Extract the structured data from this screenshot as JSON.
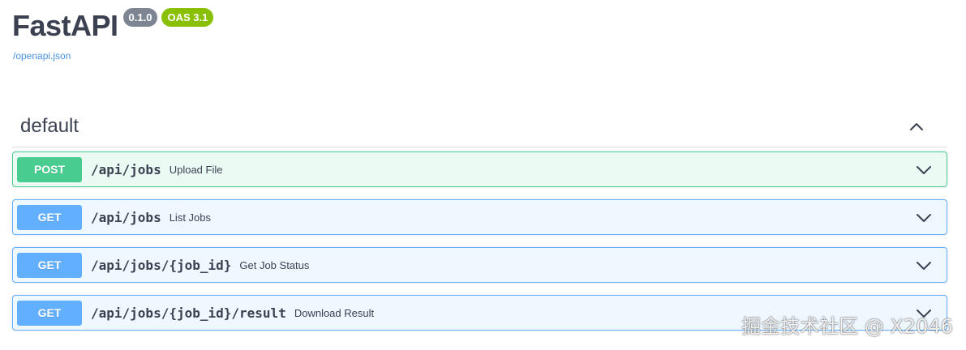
{
  "info": {
    "title": "FastAPI",
    "version_badge": "0.1.0",
    "oas_badge": "OAS 3.1",
    "spec_link": "/openapi.json"
  },
  "tag": {
    "name": "default",
    "toggle_icon": "chevron-up-icon"
  },
  "operations": [
    {
      "method": "POST",
      "path": "/api/jobs",
      "summary": "Upload File"
    },
    {
      "method": "GET",
      "path": "/api/jobs",
      "summary": "List Jobs"
    },
    {
      "method": "GET",
      "path": "/api/jobs/{job_id}",
      "summary": "Get Job Status"
    },
    {
      "method": "GET",
      "path": "/api/jobs/{job_id}/result",
      "summary": "Download Result"
    }
  ],
  "watermark": "掘金技术社区 @ X2046",
  "colors": {
    "post": "#49cc90",
    "get": "#61affe",
    "version_badge": "#7d8492",
    "oas_badge": "#89bf04",
    "link": "#4990e2"
  }
}
